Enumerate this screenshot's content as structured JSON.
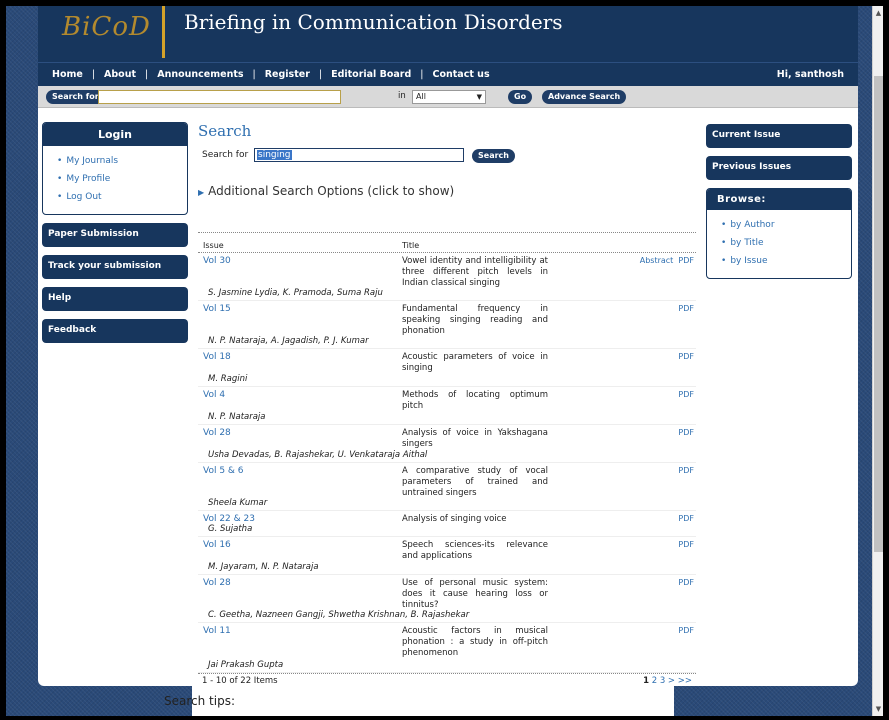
{
  "header": {
    "logo": "BiCoD",
    "title": "Briefing in Communication Disorders"
  },
  "nav": {
    "items": [
      "Home",
      "About",
      "Announcements",
      "Register",
      "Editorial Board",
      "Contact us"
    ],
    "greeting_prefix": "Hi, ",
    "user": "santhosh"
  },
  "search_bar": {
    "label": "Search for",
    "in_label": "in",
    "scope": "All",
    "go": "Go",
    "advanced": "Advance Search"
  },
  "login": {
    "heading": "Login",
    "links": [
      "My Journals",
      "My Profile",
      "Log Out"
    ]
  },
  "left_buttons": [
    "Paper Submission",
    "Track your submission",
    "Help",
    "Feedback"
  ],
  "right": {
    "current_issue": "Current Issue",
    "previous_issues": "Previous Issues",
    "browse_heading": "Browse:",
    "browse_links": [
      "by Author",
      "by Title",
      "by Issue"
    ]
  },
  "main": {
    "heading": "Search",
    "search_label": "Search for",
    "query": "singing",
    "search_button": "Search",
    "additional_options": "Additional Search Options (click to show)"
  },
  "results": {
    "col_issue": "Issue",
    "col_title": "Title",
    "rows": [
      {
        "vol": "Vol 30",
        "title": "Vowel identity and intelligibility at three different pitch levels in Indian classical singing",
        "links": "Abstract  PDF",
        "authors": "S. Jasmine Lydia, K. Pramoda, Suma Raju"
      },
      {
        "vol": "Vol 15",
        "title": "Fundamental frequency in speaking singing reading and phonation",
        "links": "PDF",
        "authors": "N. P. Nataraja, A. Jagadish, P. J. Kumar"
      },
      {
        "vol": "Vol 18",
        "title": "Acoustic parameters of voice in singing",
        "links": "PDF",
        "authors": "M. Ragini"
      },
      {
        "vol": "Vol 4",
        "title": "Methods of locating optimum pitch",
        "links": "PDF",
        "authors": "N. P. Nataraja"
      },
      {
        "vol": "Vol 28",
        "title": "Analysis of voice in Yakshagana singers",
        "links": "PDF",
        "authors": "Usha Devadas, B. Rajashekar, U. Venkataraja Aithal"
      },
      {
        "vol": "Vol 5 & 6",
        "title": "A comparative study of vocal parameters of trained and untrained singers",
        "links": "PDF",
        "authors": "Sheela Kumar"
      },
      {
        "vol": "Vol 22 & 23",
        "title": "Analysis of singing voice",
        "links": "PDF",
        "authors": "G. Sujatha"
      },
      {
        "vol": "Vol 16",
        "title": "Speech sciences-its relevance and applications",
        "links": "PDF",
        "authors": "M. Jayaram, N. P. Nataraja"
      },
      {
        "vol": "Vol 28",
        "title": "Use of personal music system: does it cause hearing loss or tinnitus?",
        "links": "PDF",
        "authors": "C. Geetha, Nazneen Gangji, Shwetha Krishnan, B. Rajashekar"
      },
      {
        "vol": "Vol 11",
        "title": "Acoustic factors in musical phonation : a study in off-pitch phenomenon",
        "links": "PDF",
        "authors": "Jai Prakash Gupta"
      }
    ],
    "count": "1 - 10 of 22 Items",
    "current_page": "1",
    "pager": "2 3 > >>"
  },
  "search_tips": "Search tips:"
}
